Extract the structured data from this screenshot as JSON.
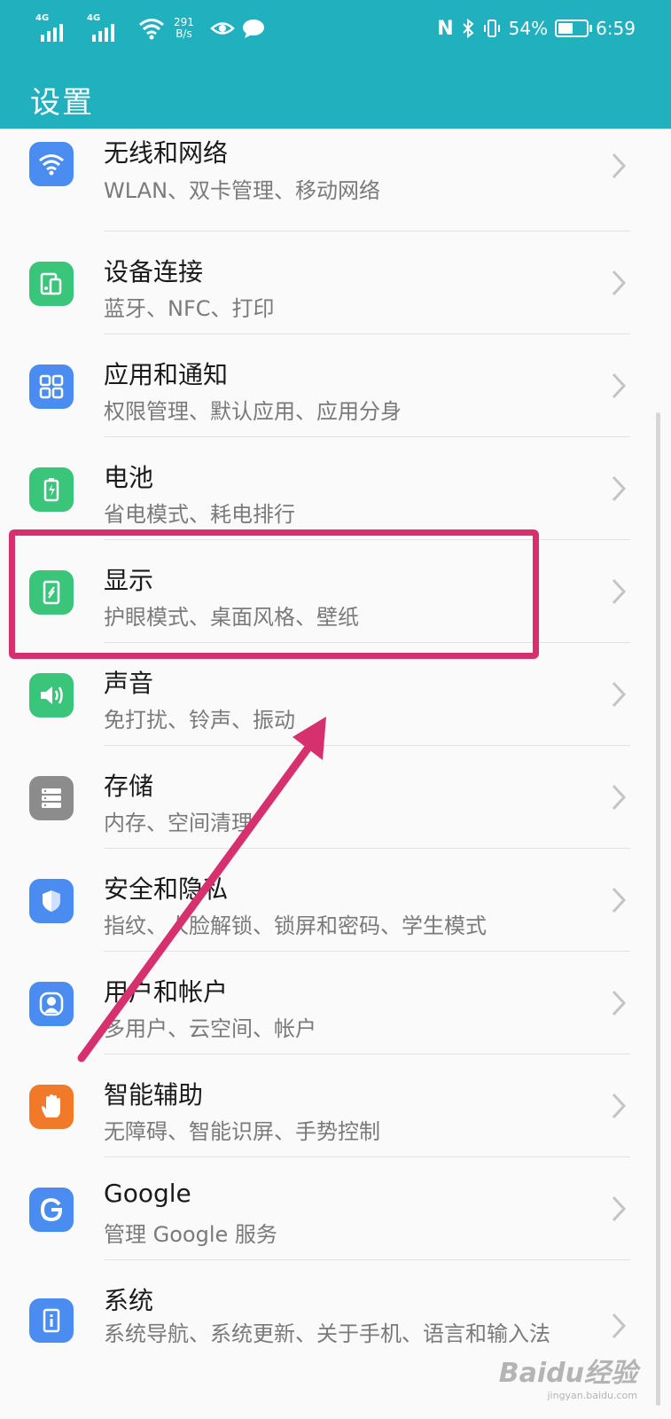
{
  "status_bar": {
    "sim1_label": "4G",
    "sim2_label": "4G",
    "net_speed_value": "291",
    "net_speed_unit": "B/s",
    "nfc_label": "N",
    "battery_percent": "54%",
    "battery_level": 0.54,
    "time": "6:59"
  },
  "header": {
    "title": "设置"
  },
  "settings": [
    {
      "title": "无线和网络",
      "subtitle": "WLAN、双卡管理、移动网络",
      "icon": "wifi-icon",
      "color": "#4a8cf0"
    },
    {
      "title": "设备连接",
      "subtitle": "蓝牙、NFC、打印",
      "icon": "device-connection-icon",
      "color": "#3bc57a"
    },
    {
      "title": "应用和通知",
      "subtitle": "权限管理、默认应用、应用分身",
      "icon": "apps-grid-icon",
      "color": "#4a8cf0"
    },
    {
      "title": "电池",
      "subtitle": "省电模式、耗电排行",
      "icon": "battery-icon",
      "color": "#3bc57a"
    },
    {
      "title": "显示",
      "subtitle": "护眼模式、桌面风格、壁纸",
      "icon": "display-icon",
      "color": "#3bc57a"
    },
    {
      "title": "声音",
      "subtitle": "免打扰、铃声、振动",
      "icon": "speaker-icon",
      "color": "#3bc57a"
    },
    {
      "title": "存储",
      "subtitle": "内存、空间清理",
      "icon": "storage-icon",
      "color": "#8c8c8c"
    },
    {
      "title": "安全和隐私",
      "subtitle": "指纹、人脸解锁、锁屏和密码、学生模式",
      "icon": "shield-icon",
      "color": "#4a8cf0"
    },
    {
      "title": "用户和帐户",
      "subtitle": "多用户、云空间、帐户",
      "icon": "user-icon",
      "color": "#4a8cf0"
    },
    {
      "title": "智能辅助",
      "subtitle": "无障碍、智能识屏、手势控制",
      "icon": "hand-icon",
      "color": "#f07a2a"
    },
    {
      "title": "Google",
      "subtitle": "管理 Google 服务",
      "icon": "google-icon",
      "color": "#4a8cf0"
    },
    {
      "title": "系统",
      "subtitle": "系统导航、系统更新、关于手机、语言和输入法",
      "icon": "system-info-icon",
      "color": "#4a8cf0"
    }
  ],
  "watermark": {
    "main": "Baidu经验",
    "sub": "jingyan.baidu.com"
  },
  "colors": {
    "header": "#21b0bd",
    "highlight": "#d7306f"
  }
}
